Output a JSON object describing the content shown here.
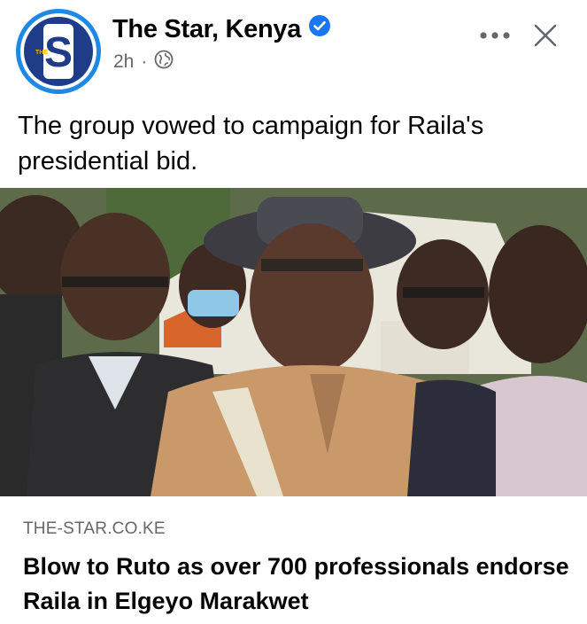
{
  "post": {
    "page_name": "The Star, Kenya",
    "verified_icon": "verified-badge-icon",
    "time": "2h",
    "separator": "·",
    "audience_icon": "globe-icon",
    "avatar_letter": "S",
    "avatar_tag": "THE",
    "text": "The group vowed to campaign for Raila's presidential bid.",
    "actions": {
      "more_icon": "more-dots-icon",
      "close_icon": "close-icon"
    }
  },
  "link_preview": {
    "domain": "THE-STAR.CO.KE",
    "title": "Blow to Ruto as over 700 professionals endorse Raila in Elgeyo Marakwet"
  },
  "colors": {
    "brand_blue": "#1e88e5",
    "verified_blue": "#1877f2",
    "secondary_text": "#65676b"
  }
}
